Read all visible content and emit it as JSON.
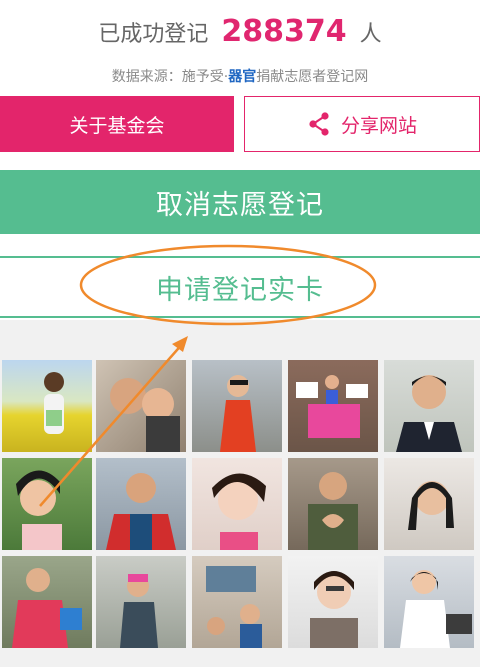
{
  "stats": {
    "prefix": "已成功登记",
    "count": "288374",
    "suffix": "人"
  },
  "source": {
    "label": "数据来源：",
    "pre": "施予受·",
    "highlight": "器官",
    "post": "捐献志愿者登记网"
  },
  "buttons": {
    "foundation": "关于基金会",
    "share": "分享网站",
    "cancel": "取消志愿登记",
    "apply": "申请登记实卡"
  },
  "colors": {
    "brand_pink": "#e3256b",
    "brand_green": "#55bd90",
    "annotation_orange": "#f08a2c"
  },
  "gallery": {
    "photos": [
      "photo",
      "photo",
      "photo",
      "photo",
      "photo",
      "photo",
      "photo",
      "photo",
      "photo",
      "photo",
      "photo",
      "photo",
      "photo",
      "photo",
      "photo"
    ]
  }
}
